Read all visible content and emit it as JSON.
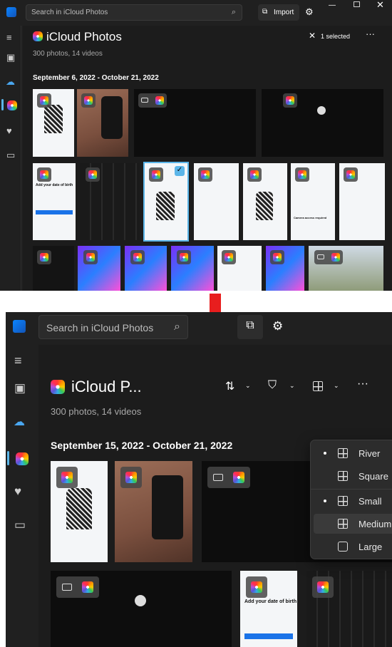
{
  "app": {
    "search_placeholder": "Search in iCloud Photos",
    "import_label": "Import",
    "title_full": "iCloud Photos",
    "title_truncated": "iCloud P...",
    "subtitle": "300 photos, 14 videos",
    "selection_label": "1 selected"
  },
  "top_panel": {
    "date_range": "September 6, 2022 - October 21, 2022"
  },
  "bottom_panel": {
    "date_range": "September 15, 2022 - October 21, 2022"
  },
  "view_menu": {
    "items": [
      {
        "label": "River",
        "icon": "river-layout-icon",
        "checked": true
      },
      {
        "label": "Square",
        "icon": "square-layout-icon",
        "checked": false
      },
      {
        "label": "Small",
        "icon": "small-grid-icon",
        "checked": true
      },
      {
        "label": "Medium",
        "icon": "medium-grid-icon",
        "checked": false,
        "hovered": true
      },
      {
        "label": "Large",
        "icon": "large-square-icon",
        "checked": false
      }
    ]
  },
  "colors": {
    "background": "#202020",
    "accent": "#5bb5e8",
    "arrow": "#e81e1e"
  },
  "screen_text": {
    "dob_title": "Add your date of birth",
    "camera_title": "Camera access required"
  }
}
